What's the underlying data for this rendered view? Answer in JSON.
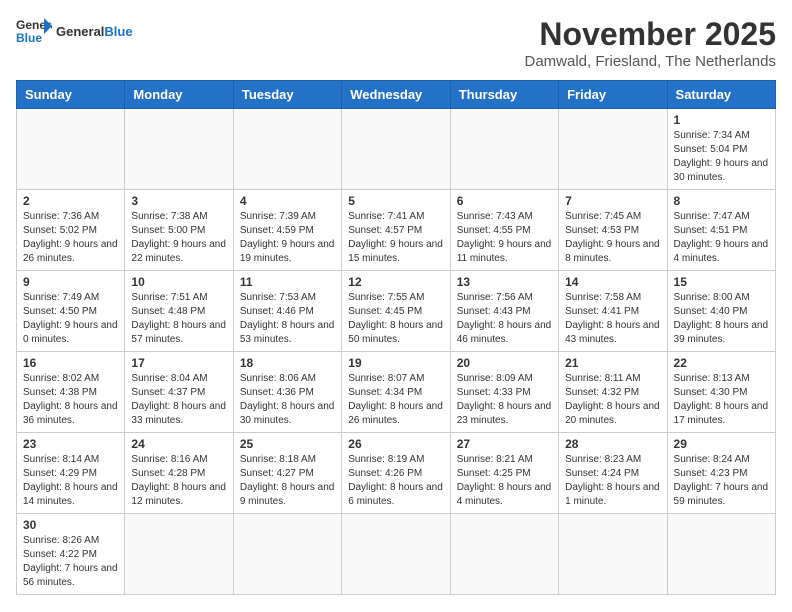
{
  "logo": {
    "text_general": "General",
    "text_blue": "Blue"
  },
  "title": "November 2025",
  "subtitle": "Damwald, Friesland, The Netherlands",
  "weekdays": [
    "Sunday",
    "Monday",
    "Tuesday",
    "Wednesday",
    "Thursday",
    "Friday",
    "Saturday"
  ],
  "weeks": [
    [
      {
        "day": "",
        "info": ""
      },
      {
        "day": "",
        "info": ""
      },
      {
        "day": "",
        "info": ""
      },
      {
        "day": "",
        "info": ""
      },
      {
        "day": "",
        "info": ""
      },
      {
        "day": "",
        "info": ""
      },
      {
        "day": "1",
        "info": "Sunrise: 7:34 AM\nSunset: 5:04 PM\nDaylight: 9 hours and 30 minutes."
      }
    ],
    [
      {
        "day": "2",
        "info": "Sunrise: 7:36 AM\nSunset: 5:02 PM\nDaylight: 9 hours and 26 minutes."
      },
      {
        "day": "3",
        "info": "Sunrise: 7:38 AM\nSunset: 5:00 PM\nDaylight: 9 hours and 22 minutes."
      },
      {
        "day": "4",
        "info": "Sunrise: 7:39 AM\nSunset: 4:59 PM\nDaylight: 9 hours and 19 minutes."
      },
      {
        "day": "5",
        "info": "Sunrise: 7:41 AM\nSunset: 4:57 PM\nDaylight: 9 hours and 15 minutes."
      },
      {
        "day": "6",
        "info": "Sunrise: 7:43 AM\nSunset: 4:55 PM\nDaylight: 9 hours and 11 minutes."
      },
      {
        "day": "7",
        "info": "Sunrise: 7:45 AM\nSunset: 4:53 PM\nDaylight: 9 hours and 8 minutes."
      },
      {
        "day": "8",
        "info": "Sunrise: 7:47 AM\nSunset: 4:51 PM\nDaylight: 9 hours and 4 minutes."
      }
    ],
    [
      {
        "day": "9",
        "info": "Sunrise: 7:49 AM\nSunset: 4:50 PM\nDaylight: 9 hours and 0 minutes."
      },
      {
        "day": "10",
        "info": "Sunrise: 7:51 AM\nSunset: 4:48 PM\nDaylight: 8 hours and 57 minutes."
      },
      {
        "day": "11",
        "info": "Sunrise: 7:53 AM\nSunset: 4:46 PM\nDaylight: 8 hours and 53 minutes."
      },
      {
        "day": "12",
        "info": "Sunrise: 7:55 AM\nSunset: 4:45 PM\nDaylight: 8 hours and 50 minutes."
      },
      {
        "day": "13",
        "info": "Sunrise: 7:56 AM\nSunset: 4:43 PM\nDaylight: 8 hours and 46 minutes."
      },
      {
        "day": "14",
        "info": "Sunrise: 7:58 AM\nSunset: 4:41 PM\nDaylight: 8 hours and 43 minutes."
      },
      {
        "day": "15",
        "info": "Sunrise: 8:00 AM\nSunset: 4:40 PM\nDaylight: 8 hours and 39 minutes."
      }
    ],
    [
      {
        "day": "16",
        "info": "Sunrise: 8:02 AM\nSunset: 4:38 PM\nDaylight: 8 hours and 36 minutes."
      },
      {
        "day": "17",
        "info": "Sunrise: 8:04 AM\nSunset: 4:37 PM\nDaylight: 8 hours and 33 minutes."
      },
      {
        "day": "18",
        "info": "Sunrise: 8:06 AM\nSunset: 4:36 PM\nDaylight: 8 hours and 30 minutes."
      },
      {
        "day": "19",
        "info": "Sunrise: 8:07 AM\nSunset: 4:34 PM\nDaylight: 8 hours and 26 minutes."
      },
      {
        "day": "20",
        "info": "Sunrise: 8:09 AM\nSunset: 4:33 PM\nDaylight: 8 hours and 23 minutes."
      },
      {
        "day": "21",
        "info": "Sunrise: 8:11 AM\nSunset: 4:32 PM\nDaylight: 8 hours and 20 minutes."
      },
      {
        "day": "22",
        "info": "Sunrise: 8:13 AM\nSunset: 4:30 PM\nDaylight: 8 hours and 17 minutes."
      }
    ],
    [
      {
        "day": "23",
        "info": "Sunrise: 8:14 AM\nSunset: 4:29 PM\nDaylight: 8 hours and 14 minutes."
      },
      {
        "day": "24",
        "info": "Sunrise: 8:16 AM\nSunset: 4:28 PM\nDaylight: 8 hours and 12 minutes."
      },
      {
        "day": "25",
        "info": "Sunrise: 8:18 AM\nSunset: 4:27 PM\nDaylight: 8 hours and 9 minutes."
      },
      {
        "day": "26",
        "info": "Sunrise: 8:19 AM\nSunset: 4:26 PM\nDaylight: 8 hours and 6 minutes."
      },
      {
        "day": "27",
        "info": "Sunrise: 8:21 AM\nSunset: 4:25 PM\nDaylight: 8 hours and 4 minutes."
      },
      {
        "day": "28",
        "info": "Sunrise: 8:23 AM\nSunset: 4:24 PM\nDaylight: 8 hours and 1 minute."
      },
      {
        "day": "29",
        "info": "Sunrise: 8:24 AM\nSunset: 4:23 PM\nDaylight: 7 hours and 59 minutes."
      }
    ],
    [
      {
        "day": "30",
        "info": "Sunrise: 8:26 AM\nSunset: 4:22 PM\nDaylight: 7 hours and 56 minutes."
      },
      {
        "day": "",
        "info": ""
      },
      {
        "day": "",
        "info": ""
      },
      {
        "day": "",
        "info": ""
      },
      {
        "day": "",
        "info": ""
      },
      {
        "day": "",
        "info": ""
      },
      {
        "day": "",
        "info": ""
      }
    ]
  ]
}
